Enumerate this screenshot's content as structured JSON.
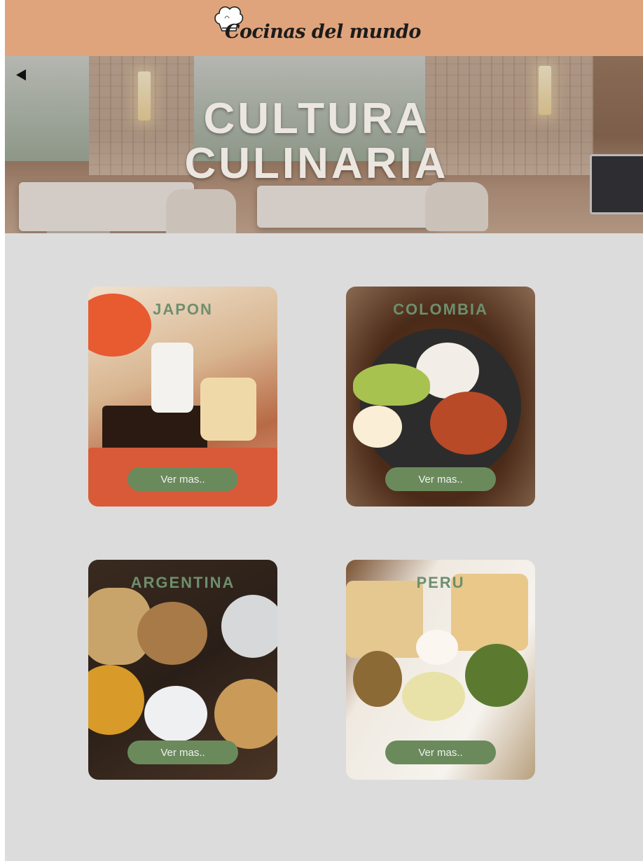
{
  "header": {
    "brand": "Cocinas del mundo",
    "logo_icon": "chef-hat-icon",
    "background": "#e0a47c"
  },
  "hero": {
    "title_line1": "CULTURA",
    "title_line2": "CULINARIA",
    "prev_icon": "left-triangle-arrow-icon"
  },
  "cards": [
    {
      "title": "JAPON",
      "button": "Ver mas.."
    },
    {
      "title": "COLOMBIA",
      "button": "Ver mas.."
    },
    {
      "title": "ARGENTINA",
      "button": "Ver mas.."
    },
    {
      "title": "PERU",
      "button": "Ver mas.."
    }
  ],
  "colors": {
    "page_background": "#dcdcdc",
    "card_title": "#6e8f6e",
    "button": "#6b8a5c",
    "button_text": "#f0f0f0"
  }
}
